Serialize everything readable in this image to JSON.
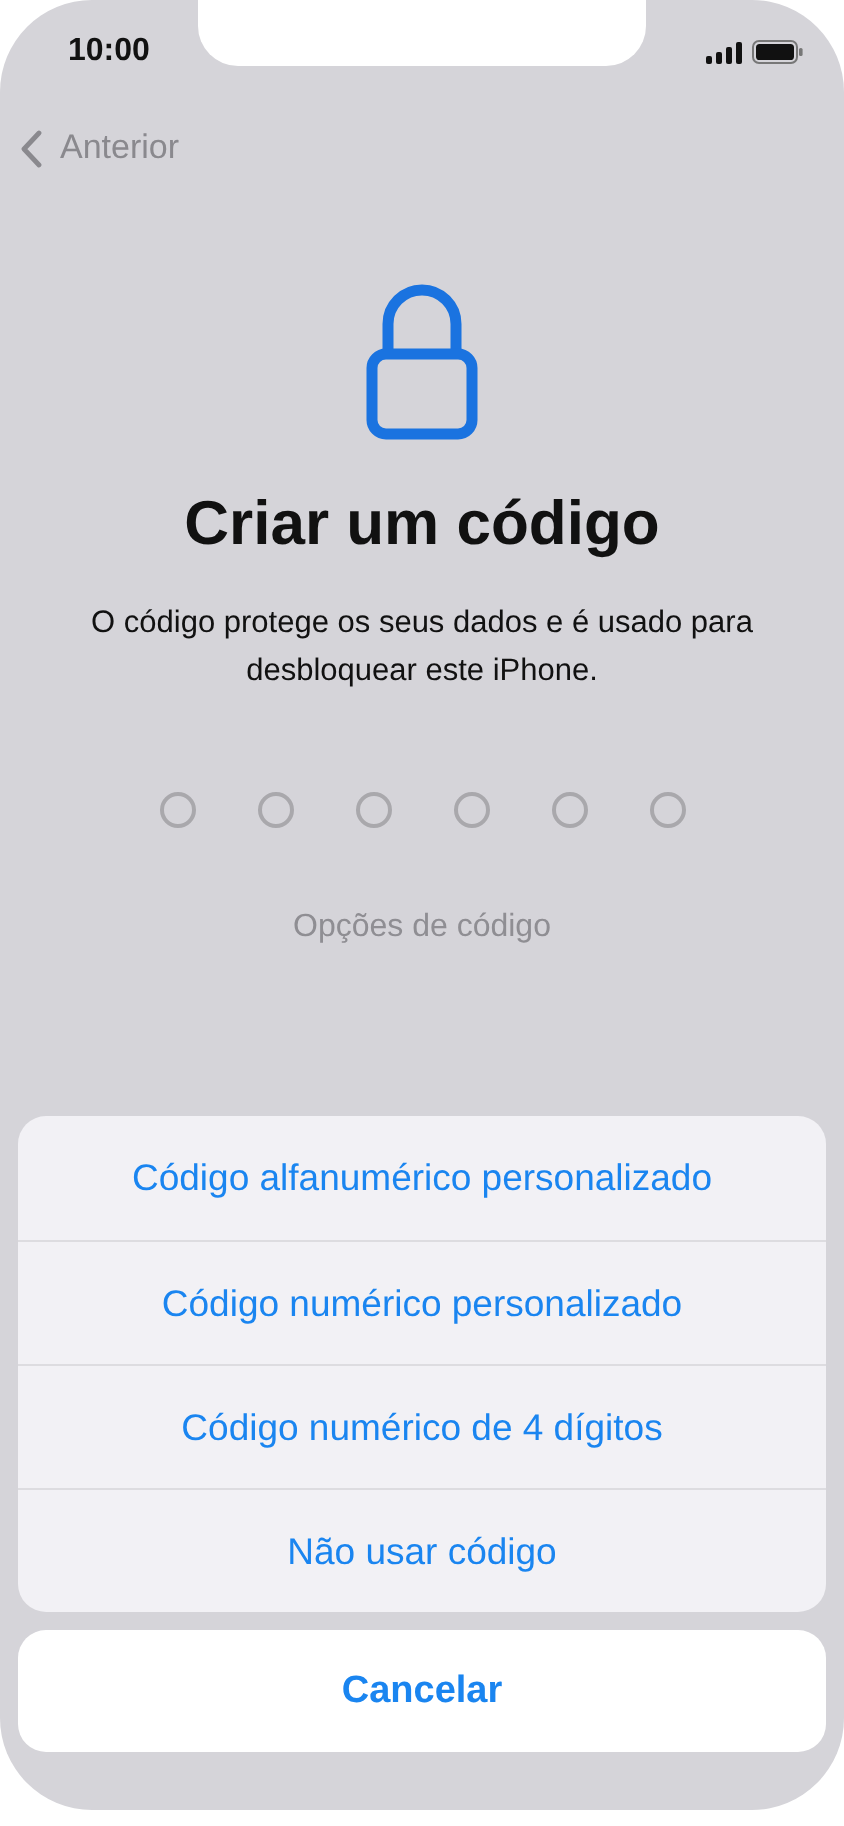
{
  "status_bar": {
    "time": "10:00"
  },
  "nav": {
    "back_label": "Anterior"
  },
  "title": "Criar um código",
  "description": "O código protege os seus dados e é usado para desbloquear este iPhone.",
  "passcode_dots": [
    {
      "filled": false
    },
    {
      "filled": false
    },
    {
      "filled": false
    },
    {
      "filled": false
    },
    {
      "filled": false
    },
    {
      "filled": false
    }
  ],
  "options_link": "Opções de código",
  "action_sheet": {
    "options": [
      {
        "label": "Código alfanumérico personalizado"
      },
      {
        "label": "Código numérico personalizado"
      },
      {
        "label": "Código numérico de 4 dígitos"
      },
      {
        "label": "Não usar código"
      }
    ],
    "cancel": "Cancelar"
  }
}
